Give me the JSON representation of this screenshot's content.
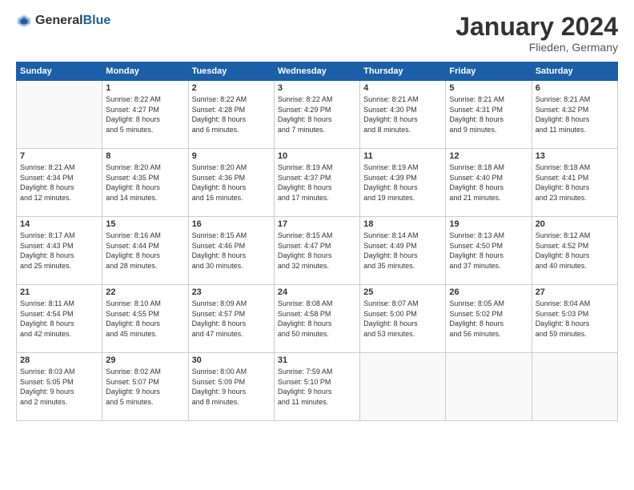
{
  "logo": {
    "general": "General",
    "blue": "Blue"
  },
  "header": {
    "month": "January 2024",
    "location": "Flieden, Germany"
  },
  "weekdays": [
    "Sunday",
    "Monday",
    "Tuesday",
    "Wednesday",
    "Thursday",
    "Friday",
    "Saturday"
  ],
  "weeks": [
    [
      {
        "day": "",
        "info": ""
      },
      {
        "day": "1",
        "info": "Sunrise: 8:22 AM\nSunset: 4:27 PM\nDaylight: 8 hours\nand 5 minutes."
      },
      {
        "day": "2",
        "info": "Sunrise: 8:22 AM\nSunset: 4:28 PM\nDaylight: 8 hours\nand 6 minutes."
      },
      {
        "day": "3",
        "info": "Sunrise: 8:22 AM\nSunset: 4:29 PM\nDaylight: 8 hours\nand 7 minutes."
      },
      {
        "day": "4",
        "info": "Sunrise: 8:21 AM\nSunset: 4:30 PM\nDaylight: 8 hours\nand 8 minutes."
      },
      {
        "day": "5",
        "info": "Sunrise: 8:21 AM\nSunset: 4:31 PM\nDaylight: 8 hours\nand 9 minutes."
      },
      {
        "day": "6",
        "info": "Sunrise: 8:21 AM\nSunset: 4:32 PM\nDaylight: 8 hours\nand 11 minutes."
      }
    ],
    [
      {
        "day": "7",
        "info": "Sunrise: 8:21 AM\nSunset: 4:34 PM\nDaylight: 8 hours\nand 12 minutes."
      },
      {
        "day": "8",
        "info": "Sunrise: 8:20 AM\nSunset: 4:35 PM\nDaylight: 8 hours\nand 14 minutes."
      },
      {
        "day": "9",
        "info": "Sunrise: 8:20 AM\nSunset: 4:36 PM\nDaylight: 8 hours\nand 16 minutes."
      },
      {
        "day": "10",
        "info": "Sunrise: 8:19 AM\nSunset: 4:37 PM\nDaylight: 8 hours\nand 17 minutes."
      },
      {
        "day": "11",
        "info": "Sunrise: 8:19 AM\nSunset: 4:39 PM\nDaylight: 8 hours\nand 19 minutes."
      },
      {
        "day": "12",
        "info": "Sunrise: 8:18 AM\nSunset: 4:40 PM\nDaylight: 8 hours\nand 21 minutes."
      },
      {
        "day": "13",
        "info": "Sunrise: 8:18 AM\nSunset: 4:41 PM\nDaylight: 8 hours\nand 23 minutes."
      }
    ],
    [
      {
        "day": "14",
        "info": "Sunrise: 8:17 AM\nSunset: 4:43 PM\nDaylight: 8 hours\nand 25 minutes."
      },
      {
        "day": "15",
        "info": "Sunrise: 8:16 AM\nSunset: 4:44 PM\nDaylight: 8 hours\nand 28 minutes."
      },
      {
        "day": "16",
        "info": "Sunrise: 8:15 AM\nSunset: 4:46 PM\nDaylight: 8 hours\nand 30 minutes."
      },
      {
        "day": "17",
        "info": "Sunrise: 8:15 AM\nSunset: 4:47 PM\nDaylight: 8 hours\nand 32 minutes."
      },
      {
        "day": "18",
        "info": "Sunrise: 8:14 AM\nSunset: 4:49 PM\nDaylight: 8 hours\nand 35 minutes."
      },
      {
        "day": "19",
        "info": "Sunrise: 8:13 AM\nSunset: 4:50 PM\nDaylight: 8 hours\nand 37 minutes."
      },
      {
        "day": "20",
        "info": "Sunrise: 8:12 AM\nSunset: 4:52 PM\nDaylight: 8 hours\nand 40 minutes."
      }
    ],
    [
      {
        "day": "21",
        "info": "Sunrise: 8:11 AM\nSunset: 4:54 PM\nDaylight: 8 hours\nand 42 minutes."
      },
      {
        "day": "22",
        "info": "Sunrise: 8:10 AM\nSunset: 4:55 PM\nDaylight: 8 hours\nand 45 minutes."
      },
      {
        "day": "23",
        "info": "Sunrise: 8:09 AM\nSunset: 4:57 PM\nDaylight: 8 hours\nand 47 minutes."
      },
      {
        "day": "24",
        "info": "Sunrise: 8:08 AM\nSunset: 4:58 PM\nDaylight: 8 hours\nand 50 minutes."
      },
      {
        "day": "25",
        "info": "Sunrise: 8:07 AM\nSunset: 5:00 PM\nDaylight: 8 hours\nand 53 minutes."
      },
      {
        "day": "26",
        "info": "Sunrise: 8:05 AM\nSunset: 5:02 PM\nDaylight: 8 hours\nand 56 minutes."
      },
      {
        "day": "27",
        "info": "Sunrise: 8:04 AM\nSunset: 5:03 PM\nDaylight: 8 hours\nand 59 minutes."
      }
    ],
    [
      {
        "day": "28",
        "info": "Sunrise: 8:03 AM\nSunset: 5:05 PM\nDaylight: 9 hours\nand 2 minutes."
      },
      {
        "day": "29",
        "info": "Sunrise: 8:02 AM\nSunset: 5:07 PM\nDaylight: 9 hours\nand 5 minutes."
      },
      {
        "day": "30",
        "info": "Sunrise: 8:00 AM\nSunset: 5:09 PM\nDaylight: 9 hours\nand 8 minutes."
      },
      {
        "day": "31",
        "info": "Sunrise: 7:59 AM\nSunset: 5:10 PM\nDaylight: 9 hours\nand 11 minutes."
      },
      {
        "day": "",
        "info": ""
      },
      {
        "day": "",
        "info": ""
      },
      {
        "day": "",
        "info": ""
      }
    ]
  ]
}
